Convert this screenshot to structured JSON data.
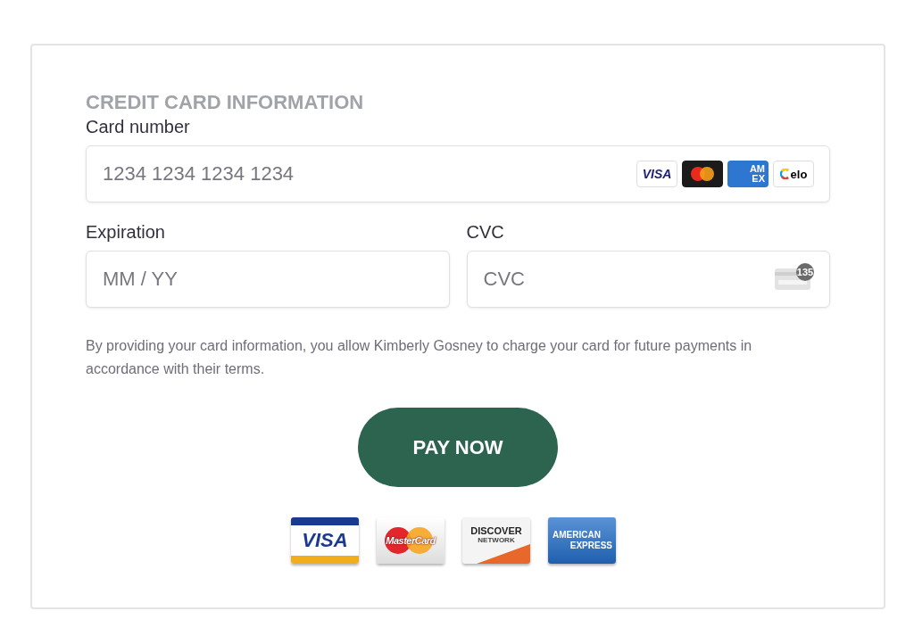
{
  "heading": "CREDIT CARD INFORMATION",
  "card_number": {
    "label": "Card number",
    "placeholder": "1234 1234 1234 1234",
    "brands": [
      {
        "kind": "visa",
        "lines": [
          "VISA"
        ]
      },
      {
        "kind": "mastercard"
      },
      {
        "kind": "amex",
        "lines": [
          "AM",
          "EX"
        ]
      },
      {
        "kind": "elo",
        "lines": [
          "elo"
        ]
      }
    ]
  },
  "expiration": {
    "label": "Expiration",
    "placeholder": "MM / YY"
  },
  "cvc": {
    "label": "CVC",
    "placeholder": "CVC",
    "badge": "135"
  },
  "notice": "By providing your card information, you allow Kimberly Gosney to charge your card for future payments in accordance with their terms.",
  "pay_button": "PAY NOW",
  "accepted_cards": [
    {
      "kind": "visa",
      "lines": [
        "VISA"
      ]
    },
    {
      "kind": "mastercard",
      "lines": [
        "MasterCard"
      ]
    },
    {
      "kind": "discover",
      "lines": [
        "DISCOVER",
        "NETWORK"
      ]
    },
    {
      "kind": "amex",
      "lines": [
        "AMERICAN",
        "EXPRESS"
      ]
    }
  ]
}
